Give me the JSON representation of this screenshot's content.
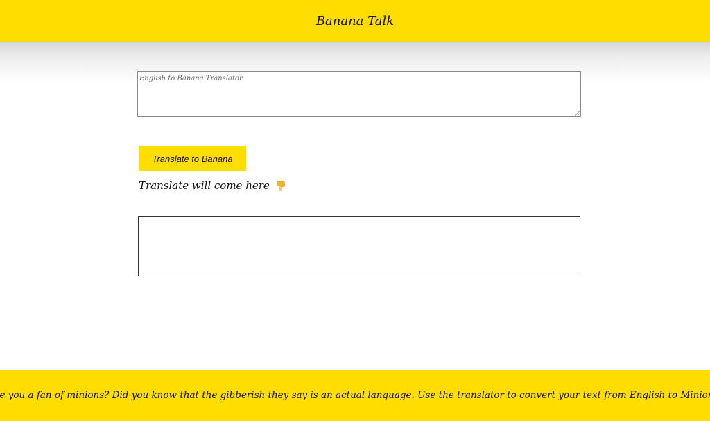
{
  "header": {
    "title": "Banana Talk"
  },
  "translator": {
    "input_placeholder": "English to Banana Translator",
    "input_value": "",
    "button_label": "Translate to Banana",
    "result_label": "Translate will come here",
    "result_icon": "backhand-index-pointing-down-icon",
    "output_text": ""
  },
  "footer": {
    "marquee_text": "re you a fan of minions? Did you know that the gibberish they say is an actual language. Use the translator to convert your text from English to Minion speak or Banana langu"
  },
  "colors": {
    "accent": "#ffdd00",
    "text": "#111111"
  }
}
